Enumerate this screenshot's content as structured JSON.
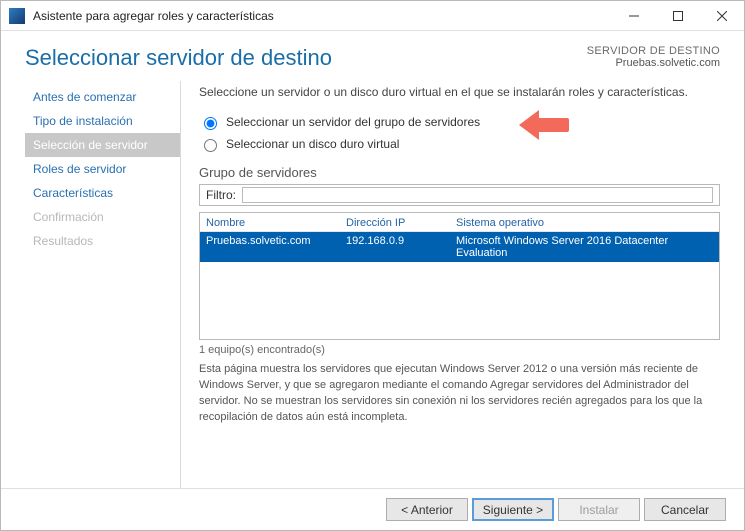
{
  "window_title": "Asistente para agregar roles y características",
  "header": {
    "page_title": "Seleccionar servidor de destino",
    "target_label": "SERVIDOR DE DESTINO",
    "target_server": "Pruebas.solvetic.com"
  },
  "steps": [
    {
      "label": "Antes de comenzar",
      "state": "enabled"
    },
    {
      "label": "Tipo de instalación",
      "state": "enabled"
    },
    {
      "label": "Selección de servidor",
      "state": "active"
    },
    {
      "label": "Roles de servidor",
      "state": "enabled"
    },
    {
      "label": "Características",
      "state": "enabled"
    },
    {
      "label": "Confirmación",
      "state": "disabled"
    },
    {
      "label": "Resultados",
      "state": "disabled"
    }
  ],
  "main": {
    "instruction": "Seleccione un servidor o un disco duro virtual en el que se instalarán roles y características.",
    "radio1": "Seleccionar un servidor del grupo de servidores",
    "radio2": "Seleccionar un disco duro virtual",
    "section_label": "Grupo de servidores",
    "filter_label": "Filtro:",
    "filter_value": "",
    "table": {
      "columns": [
        "Nombre",
        "Dirección IP",
        "Sistema operativo"
      ],
      "rows": [
        {
          "name": "Pruebas.solvetic.com",
          "ip": "192.168.0.9",
          "os": "Microsoft Windows Server 2016 Datacenter Evaluation"
        }
      ]
    },
    "count_text": "1 equipo(s) encontrado(s)",
    "description": "Esta página muestra los servidores que ejecutan Windows Server 2012 o una versión más reciente de Windows Server, y que se agregaron mediante el comando Agregar servidores del Administrador del servidor. No se muestran los servidores sin conexión ni los servidores recién agregados para los que la recopilación de datos aún está incompleta."
  },
  "footer": {
    "prev": "< Anterior",
    "next": "Siguiente >",
    "install": "Instalar",
    "cancel": "Cancelar"
  }
}
